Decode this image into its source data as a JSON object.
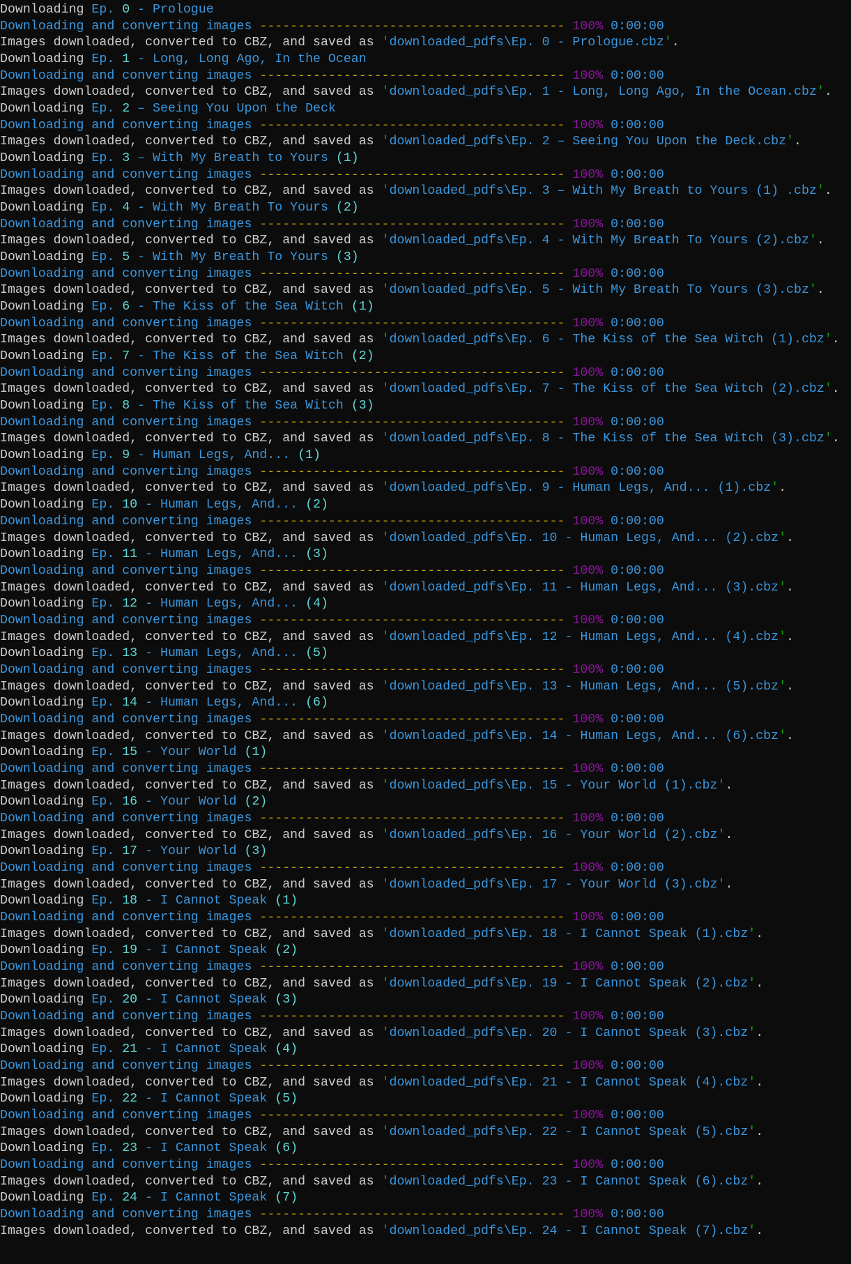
{
  "colors": {
    "background": "#0c0c0c",
    "text": "#cccccc",
    "cyan": "#3a96dd",
    "bright_cyan": "#61d6d6",
    "yellow": "#c19c00",
    "purple": "#881798",
    "green": "#13a10e"
  },
  "labels": {
    "downloading": "Downloading",
    "progress_label": "Downloading and converting images",
    "progress_bar": "----------------------------------------",
    "percent": "100%",
    "elapsed": "0:00:00",
    "saved_prefix": "Images downloaded, converted to CBZ, and saved as ",
    "folder": "downloaded_pdfs\\",
    "quote": "'",
    "period": "."
  },
  "episodes": [
    {
      "title": "Ep. 0 - Prologue",
      "file": "Ep. 0 - Prologue.cbz"
    },
    {
      "title": "Ep. 1 - Long, Long Ago, In the Ocean",
      "file": "Ep. 1 - Long, Long Ago, In the Ocean.cbz"
    },
    {
      "title": "Ep. 2 – Seeing You Upon the Deck",
      "file": "Ep. 2 – Seeing You Upon the Deck.cbz"
    },
    {
      "title": "Ep. 3 – With My Breath to Yours (1)",
      "file": "Ep. 3 – With My Breath to Yours (1) .cbz"
    },
    {
      "title": "Ep. 4 - With My Breath To Yours (2)",
      "file": "Ep. 4 - With My Breath To Yours (2).cbz"
    },
    {
      "title": "Ep. 5 - With My Breath To Yours (3)",
      "file": "Ep. 5 - With My Breath To Yours (3).cbz"
    },
    {
      "title": "Ep. 6 - The Kiss of the Sea Witch (1)",
      "file": "Ep. 6 - The Kiss of the Sea Witch (1).cbz"
    },
    {
      "title": "Ep. 7 - The Kiss of the Sea Witch (2)",
      "file": "Ep. 7 - The Kiss of the Sea Witch (2).cbz"
    },
    {
      "title": "Ep. 8 - The Kiss of the Sea Witch (3)",
      "file": "Ep. 8 - The Kiss of the Sea Witch (3).cbz"
    },
    {
      "title": "Ep. 9 - Human Legs, And... (1)",
      "file": "Ep. 9 - Human Legs, And... (1).cbz"
    },
    {
      "title": "Ep. 10 - Human Legs, And... (2)",
      "file": "Ep. 10 - Human Legs, And... (2).cbz"
    },
    {
      "title": "Ep. 11 - Human Legs, And... (3)",
      "file": "Ep. 11 - Human Legs, And... (3).cbz"
    },
    {
      "title": "Ep. 12 - Human Legs, And... (4)",
      "file": "Ep. 12 - Human Legs, And... (4).cbz"
    },
    {
      "title": "Ep. 13 - Human Legs, And... (5)",
      "file": "Ep. 13 - Human Legs, And... (5).cbz"
    },
    {
      "title": "Ep. 14 - Human Legs, And... (6)",
      "file": "Ep. 14 - Human Legs, And... (6).cbz"
    },
    {
      "title": "Ep. 15 - Your World (1)",
      "file": "Ep. 15 - Your World (1).cbz"
    },
    {
      "title": "Ep. 16 - Your World (2)",
      "file": "Ep. 16 - Your World (2).cbz"
    },
    {
      "title": "Ep. 17 - Your World (3)",
      "file": "Ep. 17 - Your World (3).cbz"
    },
    {
      "title": "Ep. 18 - I Cannot Speak (1)",
      "file": "Ep. 18 - I Cannot Speak (1).cbz"
    },
    {
      "title": "Ep. 19 - I Cannot Speak (2)",
      "file": "Ep. 19 - I Cannot Speak (2).cbz"
    },
    {
      "title": "Ep. 20 - I Cannot Speak (3)",
      "file": "Ep. 20 - I Cannot Speak (3).cbz"
    },
    {
      "title": "Ep. 21 - I Cannot Speak (4)",
      "file": "Ep. 21 - I Cannot Speak (4).cbz"
    },
    {
      "title": "Ep. 22 - I Cannot Speak (5)",
      "file": "Ep. 22 - I Cannot Speak (5).cbz"
    },
    {
      "title": "Ep. 23 - I Cannot Speak (6)",
      "file": "Ep. 23 - I Cannot Speak (6).cbz"
    },
    {
      "title": "Ep. 24 - I Cannot Speak (7)",
      "file": "Ep. 24 - I Cannot Speak (7).cbz"
    }
  ]
}
